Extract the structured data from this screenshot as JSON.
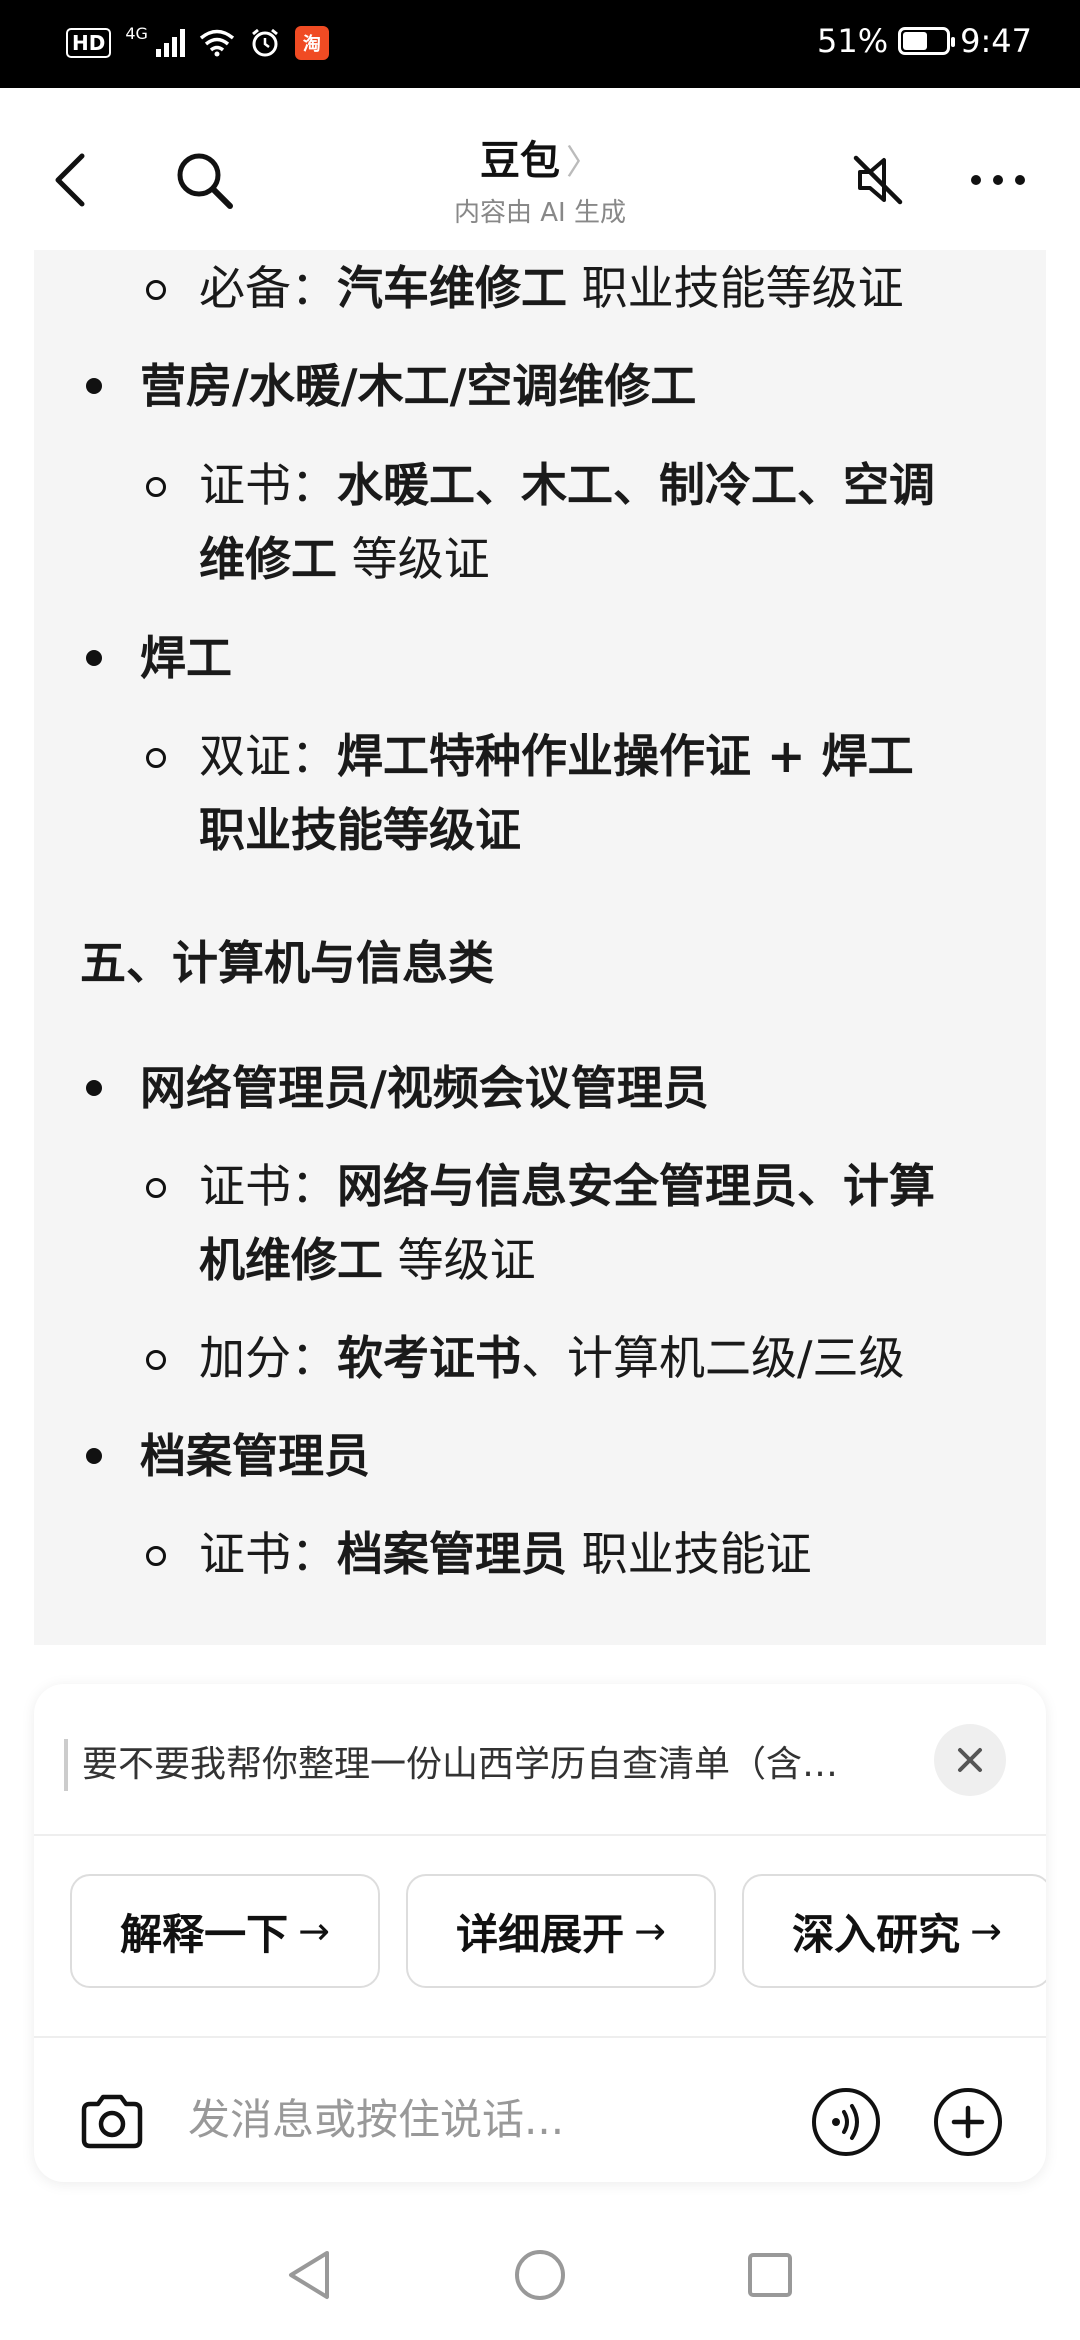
{
  "status_bar": {
    "hd_label": "HD",
    "network_label": "4G",
    "app_badge": "淘",
    "battery": "51%",
    "battery_level": 0.51,
    "time": "9:47"
  },
  "header": {
    "title": "豆包",
    "title_chevron": "〉",
    "subtitle": "内容由 AI 生成",
    "icons": [
      "back-arrow-icon",
      "search-icon",
      "mute-speaker-icon",
      "more-options-icon"
    ]
  },
  "content": {
    "lines": [
      {
        "type": "sub",
        "parts": [
          {
            "t": "必备：",
            "b": false
          },
          {
            "t": "汽车维修工",
            "b": true
          },
          {
            "t": " 职业技能等级证",
            "b": false
          }
        ]
      },
      {
        "type": "bullet",
        "parts": [
          {
            "t": "营房/水暖/木工/空调维修工",
            "b": true
          }
        ]
      },
      {
        "type": "sub",
        "parts": [
          {
            "t": "证书：",
            "b": false
          },
          {
            "t": "水暖工、木工、制冷工、空调",
            "b": true
          }
        ]
      },
      {
        "type": "cont",
        "parts": [
          {
            "t": "维修工",
            "b": true
          },
          {
            "t": " 等级证",
            "b": false
          }
        ]
      },
      {
        "type": "bullet",
        "parts": [
          {
            "t": "焊工",
            "b": true
          }
        ]
      },
      {
        "type": "sub",
        "parts": [
          {
            "t": "双证：",
            "b": false
          },
          {
            "t": "焊工特种作业操作证 + 焊工",
            "b": true
          }
        ]
      },
      {
        "type": "cont",
        "parts": [
          {
            "t": "职业技能等级证",
            "b": true
          }
        ]
      },
      {
        "type": "heading",
        "parts": [
          {
            "t": "五、计算机与信息类",
            "b": true
          }
        ]
      },
      {
        "type": "bullet",
        "parts": [
          {
            "t": "网络管理员/视频会议管理员",
            "b": true
          }
        ]
      },
      {
        "type": "sub",
        "parts": [
          {
            "t": "证书：",
            "b": false
          },
          {
            "t": "网络与信息安全管理员、计算",
            "b": true
          }
        ]
      },
      {
        "type": "cont",
        "parts": [
          {
            "t": "机维修工",
            "b": true
          },
          {
            "t": " 等级证",
            "b": false
          }
        ]
      },
      {
        "type": "sub",
        "parts": [
          {
            "t": "加分：",
            "b": false
          },
          {
            "t": "软考证书",
            "b": true
          },
          {
            "t": "、计算机二级/三级",
            "b": false
          }
        ]
      },
      {
        "type": "bullet",
        "parts": [
          {
            "t": "档案管理员",
            "b": true
          }
        ]
      },
      {
        "type": "sub",
        "parts": [
          {
            "t": "证书：",
            "b": false
          },
          {
            "t": "档案管理员",
            "b": true
          },
          {
            "t": " 职业技能证",
            "b": false
          }
        ]
      }
    ]
  },
  "suggestion": {
    "text": "要不要我帮你整理一份山西学历自查清单（含…",
    "chips": [
      {
        "label": "解释一下",
        "arrow": "→"
      },
      {
        "label": "详细展开",
        "arrow": "→"
      },
      {
        "label": "深入研究",
        "arrow": "→"
      }
    ]
  },
  "composer": {
    "placeholder": "发消息或按住说话..."
  },
  "colors": {
    "content_bg": "#f5f5f5",
    "status_bg": "#000000",
    "app_badge": "#f04b23"
  }
}
